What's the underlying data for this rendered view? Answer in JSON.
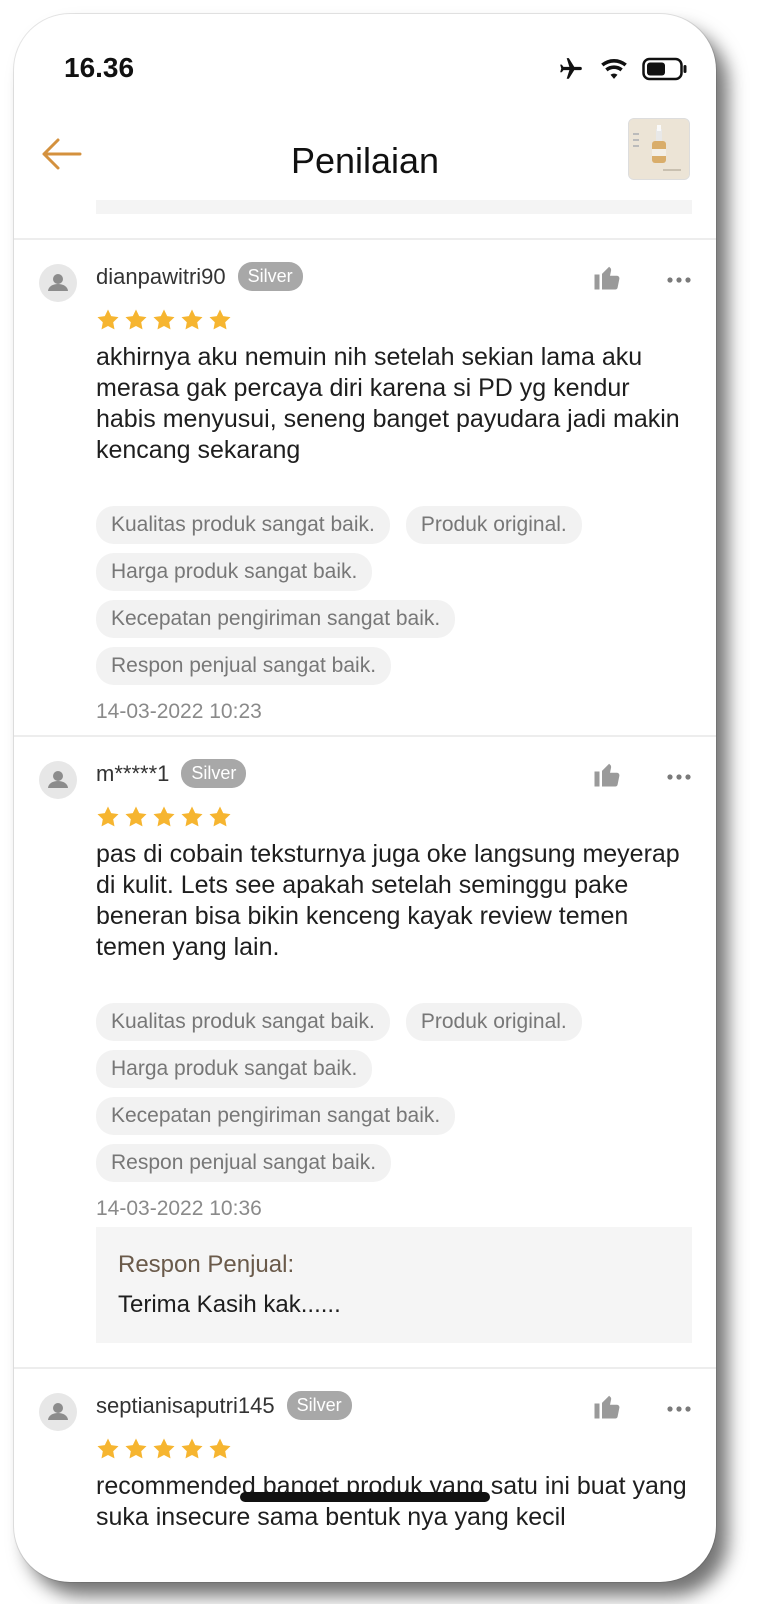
{
  "status_bar": {
    "time": "16.36"
  },
  "header": {
    "title": "Penilaian"
  },
  "reviews": [
    {
      "username": "dianpawitri90",
      "badge": "Silver",
      "rating": 5,
      "text": "akhirnya aku nemuin nih setelah sekian lama aku merasa gak percaya diri karena si PD yg kendur habis menyusui, seneng banget payudara jadi makin kencang sekarang",
      "tags": [
        "Kualitas produk sangat baik.",
        "Produk original.",
        "Harga produk sangat baik.",
        "Kecepatan pengiriman sangat baik.",
        "Respon penjual sangat baik."
      ],
      "date": "14-03-2022 10:23"
    },
    {
      "username": "m*****1",
      "badge": "Silver",
      "rating": 5,
      "text": "pas di cobain teksturnya juga oke langsung meyerap di kulit. Lets see apakah setelah seminggu pake beneran bisa bikin kenceng kayak review temen temen yang lain.",
      "tags": [
        "Kualitas produk sangat baik.",
        "Produk original.",
        "Harga produk sangat baik.",
        "Kecepatan pengiriman sangat baik.",
        "Respon penjual sangat baik."
      ],
      "date": "14-03-2022 10:36",
      "seller_response": {
        "label": "Respon Penjual:",
        "text": "Terima Kasih kak......"
      }
    },
    {
      "username": "septianisaputri145",
      "badge": "Silver",
      "rating": 5,
      "text": "recommended banget produk yang satu ini buat yang suka insecure sama bentuk nya yang kecil"
    }
  ],
  "colors": {
    "accent": "#d4913e",
    "star": "#f6b530",
    "badge": "#a8a8a8"
  },
  "icons": [
    "airplane-icon",
    "wifi-icon",
    "battery-icon",
    "back-arrow-icon",
    "thumbs-up-icon",
    "more-icon",
    "star-icon",
    "avatar-icon"
  ]
}
